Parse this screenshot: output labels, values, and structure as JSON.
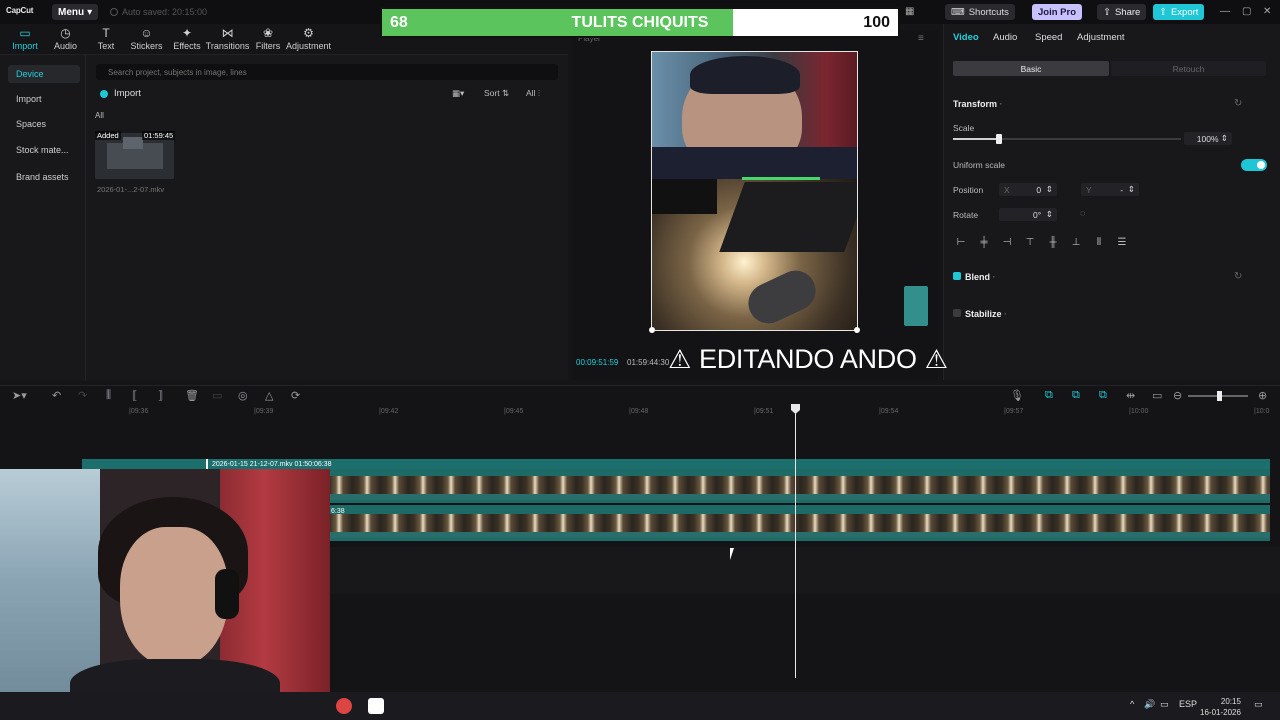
{
  "titlebar": {
    "logo": "CapCut",
    "menu_label": "Menu",
    "autosaved": "Auto saved: 20:15:00",
    "shortcuts_label": "Shortcuts",
    "joinpro_label": "Join Pro",
    "share_label": "Share",
    "export_label": "Export"
  },
  "score": {
    "left_value": "68",
    "title": "TULITS CHIQUITS",
    "right_value": "100",
    "fill_fraction": 0.68,
    "fill_color": "#5cc45c"
  },
  "toolstrip": [
    {
      "label": "Import",
      "icon": "import-icon",
      "active": true
    },
    {
      "label": "Audio",
      "icon": "audio-icon",
      "active": false
    },
    {
      "label": "Text",
      "icon": "text-icon",
      "active": false
    },
    {
      "label": "Stickers",
      "icon": "sticker-icon",
      "active": false
    },
    {
      "label": "Effects",
      "icon": "effects-icon",
      "active": false
    },
    {
      "label": "Transitions",
      "icon": "transitions-icon",
      "active": false
    },
    {
      "label": "Filters",
      "icon": "filters-icon",
      "active": false
    },
    {
      "label": "Adjustment",
      "icon": "adjustment-icon",
      "active": false
    }
  ],
  "sidenav": {
    "device": "Device",
    "import": "Import",
    "spaces": "Spaces",
    "stock": "Stock mate...",
    "brand": "Brand assets"
  },
  "media": {
    "search_placeholder": "Search project, subjects in image, lines",
    "import_label": "Import",
    "sort_label": "Sort",
    "all_filter": "All",
    "all_tag": "All",
    "added_badge": "Added",
    "duration_badge": "01:59:45",
    "file_name": "2026-01-...2-07.mkv"
  },
  "player": {
    "label": "Player",
    "time_current": "00:09:51:59",
    "time_total": "01:59:44:30"
  },
  "overlay": {
    "warn_left": "⚠",
    "text": "EDITANDO ANDO",
    "warn_right": "⚠"
  },
  "rightpanel": {
    "tabs": {
      "video": "Video",
      "audio": "Audio",
      "speed": "Speed",
      "adjustment": "Adjustment"
    },
    "basic": "Basic",
    "retouch": "Retouch",
    "transform": "Transform",
    "scale_label": "Scale",
    "scale_value": "100%",
    "scale_fraction": 0.2,
    "uniform_scale": "Uniform scale",
    "uniform_scale_on": true,
    "position_label": "Position",
    "pos_x_label": "X",
    "pos_x": "0",
    "pos_y_label": "Y",
    "pos_y": "-",
    "rotate_label": "Rotate",
    "rotate_value": "0°",
    "blend": "Blend",
    "stabilize": "Stabilize",
    "accent": "#21d0de"
  },
  "timeline": {
    "ticks": [
      "|09:36",
      "|09:39",
      "|09:42",
      "|09:45",
      "|09:48",
      "|09:51",
      "|09:54",
      "|09:57",
      "|10:00",
      "|10:0"
    ],
    "clip_label": "2026-01-15 21-12-07.mkv  01:50:06:38",
    "clip_sublabel": "6:38"
  },
  "taskbar": {
    "lang": "ESP",
    "time": "20:15",
    "date": "16-01-2026"
  }
}
